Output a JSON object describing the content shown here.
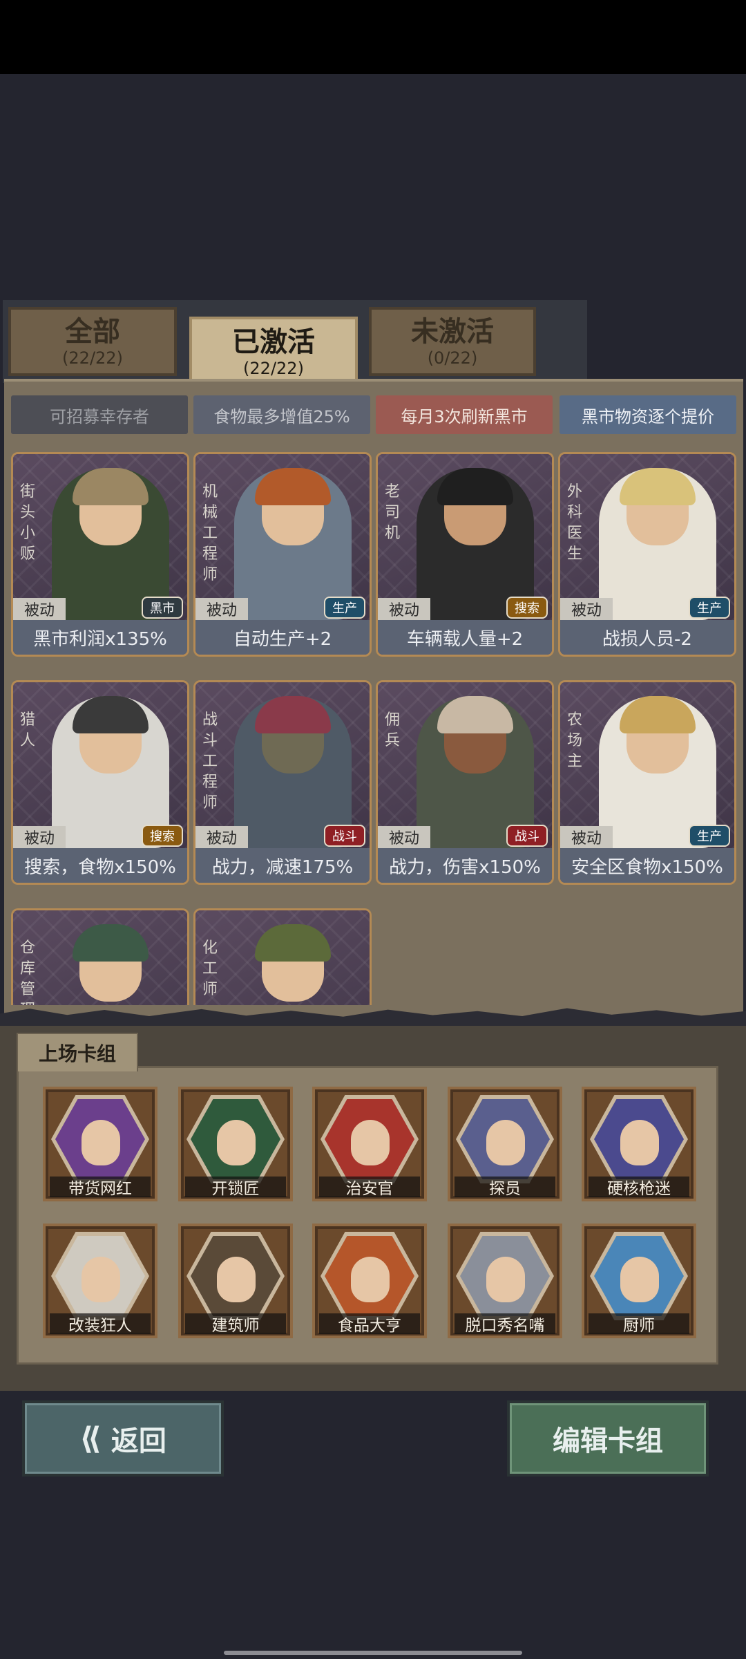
{
  "tabs": [
    {
      "label": "全部",
      "count": "(22/22)"
    },
    {
      "label": "已激活",
      "count": "(22/22)"
    },
    {
      "label": "未激活",
      "count": "(0/22)"
    }
  ],
  "effects": [
    "可招募幸存者",
    "食物最多增值25%",
    "每月3次刷新黑市",
    "黑市物资逐个提价"
  ],
  "survivors": [
    {
      "role": "街头小贩",
      "passive": "被动",
      "tag": "黑市",
      "effect": "黑市利润x135%"
    },
    {
      "role": "机械工程师",
      "passive": "被动",
      "tag": "生产",
      "effect": "自动生产+2"
    },
    {
      "role": "老司机",
      "passive": "被动",
      "tag": "搜索",
      "effect": "车辆载人量+2"
    },
    {
      "role": "外科医生",
      "passive": "被动",
      "tag": "生产",
      "effect": "战损人员-2"
    },
    {
      "role": "猎人",
      "passive": "被动",
      "tag": "搜索",
      "effect": "搜索，食物x150%"
    },
    {
      "role": "战斗工程师",
      "passive": "被动",
      "tag": "战斗",
      "effect": "战力，减速175%"
    },
    {
      "role": "佣兵",
      "passive": "被动",
      "tag": "战斗",
      "effect": "战力，伤害x150%"
    },
    {
      "role": "农场主",
      "passive": "被动",
      "tag": "生产",
      "effect": "安全区食物x150%"
    },
    {
      "role": "仓库管理"
    },
    {
      "role": "化工师"
    }
  ],
  "deck": {
    "title": "上场卡组",
    "cards": [
      "带货网红",
      "开锁匠",
      "治安官",
      "探员",
      "硬核枪迷",
      "改装狂人",
      "建筑师",
      "食品大亨",
      "脱口秀名嘴",
      "厨师"
    ]
  },
  "buttons": {
    "back": "返回",
    "edit": "编辑卡组"
  }
}
